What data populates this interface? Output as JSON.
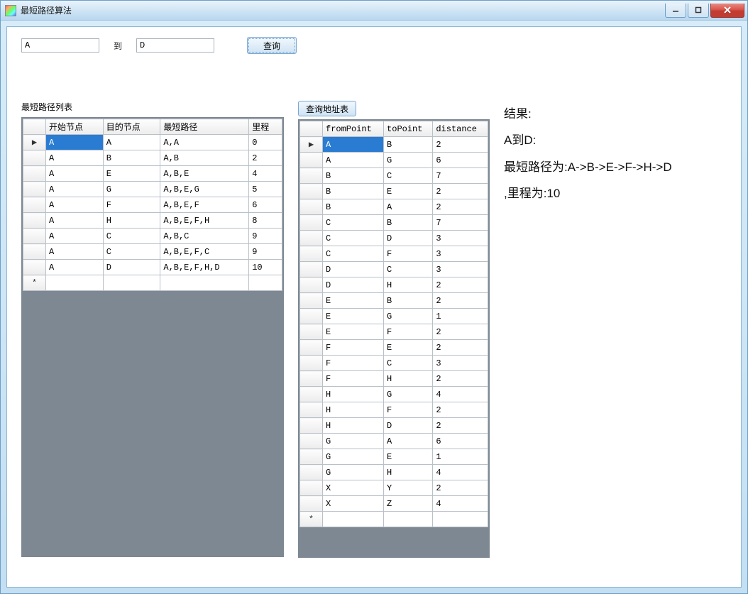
{
  "window": {
    "title": "最短路径算法"
  },
  "inputs": {
    "from": "A",
    "to_label": "到",
    "to": "D",
    "query_btn": "查询"
  },
  "left": {
    "title": "最短路径列表",
    "headers": [
      "开始节点",
      "目的节点",
      "最短路径",
      "里程"
    ],
    "rows": [
      {
        "start": "A",
        "dest": "A",
        "path": "A,A",
        "dist": "0"
      },
      {
        "start": "A",
        "dest": "B",
        "path": "A,B",
        "dist": "2"
      },
      {
        "start": "A",
        "dest": "E",
        "path": "A,B,E",
        "dist": "4"
      },
      {
        "start": "A",
        "dest": "G",
        "path": "A,B,E,G",
        "dist": "5"
      },
      {
        "start": "A",
        "dest": "F",
        "path": "A,B,E,F",
        "dist": "6"
      },
      {
        "start": "A",
        "dest": "H",
        "path": "A,B,E,F,H",
        "dist": "8"
      },
      {
        "start": "A",
        "dest": "C",
        "path": "A,B,C",
        "dist": "9"
      },
      {
        "start": "A",
        "dest": "C",
        "path": "A,B,E,F,C",
        "dist": "9"
      },
      {
        "start": "A",
        "dest": "D",
        "path": "A,B,E,F,H,D",
        "dist": "10"
      }
    ]
  },
  "mid": {
    "query_btn": "查询地址表",
    "headers": [
      "fromPoint",
      "toPoint",
      "distance"
    ],
    "rows": [
      {
        "from": "A",
        "to": "B",
        "d": "2"
      },
      {
        "from": "A",
        "to": "G",
        "d": "6"
      },
      {
        "from": "B",
        "to": "C",
        "d": "7"
      },
      {
        "from": "B",
        "to": "E",
        "d": "2"
      },
      {
        "from": "B",
        "to": "A",
        "d": "2"
      },
      {
        "from": "C",
        "to": "B",
        "d": "7"
      },
      {
        "from": "C",
        "to": "D",
        "d": "3"
      },
      {
        "from": "C",
        "to": "F",
        "d": "3"
      },
      {
        "from": "D",
        "to": "C",
        "d": "3"
      },
      {
        "from": "D",
        "to": "H",
        "d": "2"
      },
      {
        "from": "E",
        "to": "B",
        "d": "2"
      },
      {
        "from": "E",
        "to": "G",
        "d": "1"
      },
      {
        "from": "E",
        "to": "F",
        "d": "2"
      },
      {
        "from": "F",
        "to": "E",
        "d": "2"
      },
      {
        "from": "F",
        "to": "C",
        "d": "3"
      },
      {
        "from": "F",
        "to": "H",
        "d": "2"
      },
      {
        "from": "H",
        "to": "G",
        "d": "4"
      },
      {
        "from": "H",
        "to": "F",
        "d": "2"
      },
      {
        "from": "H",
        "to": "D",
        "d": "2"
      },
      {
        "from": "G",
        "to": "A",
        "d": "6"
      },
      {
        "from": "G",
        "to": "E",
        "d": "1"
      },
      {
        "from": "G",
        "to": "H",
        "d": "4"
      },
      {
        "from": "X",
        "to": "Y",
        "d": "2"
      },
      {
        "from": "X",
        "to": "Z",
        "d": "4"
      }
    ]
  },
  "result": {
    "title": "结果:",
    "line1": "A到D:",
    "line2": "最短路径为:A->B->E->F->H->D",
    "line3": ",里程为:10"
  }
}
